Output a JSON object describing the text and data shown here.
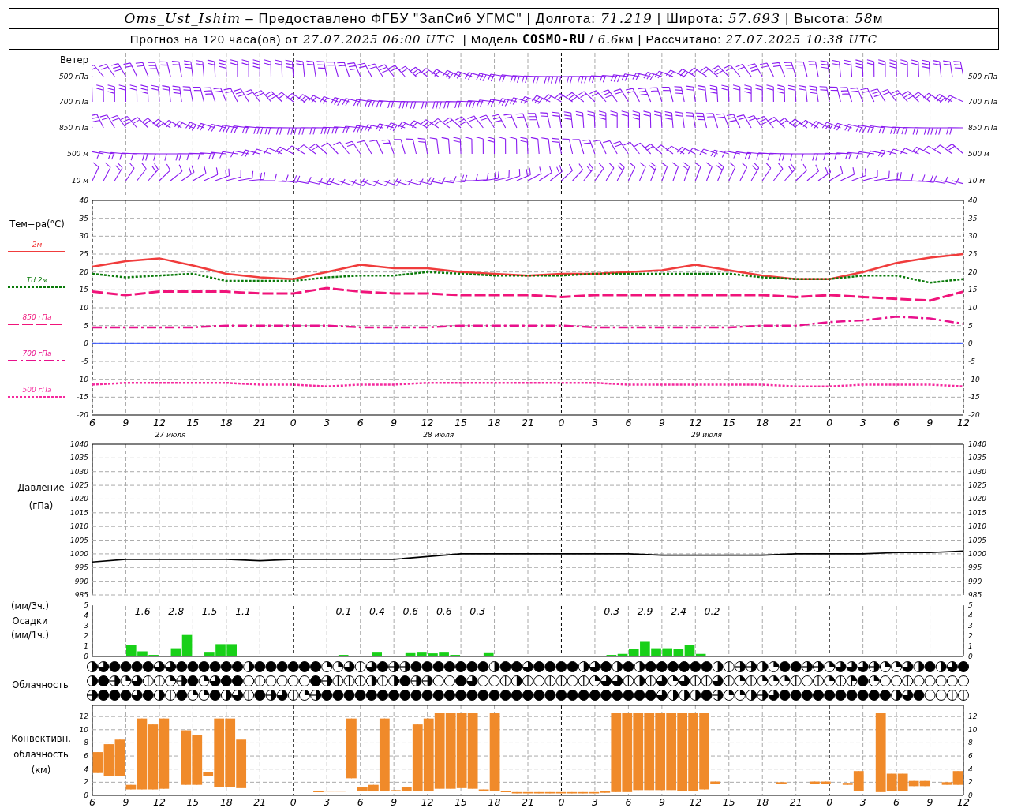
{
  "header": {
    "lines": [
      [
        {
          "text": "Oms_Ust_Ishim",
          "kind": "italic"
        },
        {
          "text": " – Предоставлено ФГБУ \"ЗапСиб УГМС\" | Долгота: ",
          "kind": "plain"
        },
        {
          "text": "71.219",
          "kind": "italic"
        },
        {
          "text": " | Широта: ",
          "kind": "plain"
        },
        {
          "text": "57.693",
          "kind": "italic"
        },
        {
          "text": " | Высота: ",
          "kind": "plain"
        },
        {
          "text": "58",
          "kind": "italic"
        },
        {
          "text": "м",
          "kind": "plain"
        }
      ],
      [
        {
          "text": "Прогноз на 120 часа(ов) от ",
          "kind": "plain"
        },
        {
          "text": "27.07.2025 06:00 UTC",
          "kind": "italic"
        },
        {
          "text": "  | Модель ",
          "kind": "plain"
        },
        {
          "text": "COSMO-RU",
          "kind": "bold"
        },
        {
          "text": " / ",
          "kind": "plain"
        },
        {
          "text": "6.6",
          "kind": "italic"
        },
        {
          "text": "км | Рассчитано: ",
          "kind": "plain"
        },
        {
          "text": "27.07.2025 10:38 UTC",
          "kind": "italic"
        }
      ]
    ]
  },
  "wind": {
    "title": "Ветер",
    "levels_left": [
      "500 гПа",
      "700 гПа",
      "850 гПа",
      "500 м",
      "10  м"
    ],
    "levels_right": [
      "500 гПа",
      "700 гПа",
      "850 гПа",
      "500 м",
      "10  м"
    ]
  },
  "temperature": {
    "chart_data": {
      "type": "line",
      "ylabel": "Тем−ра(°С)",
      "grid": true,
      "x": [
        "6",
        "9",
        "12",
        "15",
        "18",
        "21",
        "0",
        "3",
        "6",
        "9",
        "12",
        "15",
        "18",
        "21",
        "0",
        "3",
        "6",
        "9",
        "12",
        "15",
        "18",
        "21",
        "0",
        "3",
        "6",
        "9",
        "12"
      ],
      "ylim": [
        -20,
        40
      ],
      "yticks": [
        40,
        35,
        30,
        25,
        20,
        15,
        10,
        5,
        0,
        -5,
        -10,
        -15,
        -20
      ],
      "ref_lines": [
        {
          "axis": "y",
          "value": 0,
          "color": "#3050ff"
        }
      ],
      "series": [
        {
          "name": "2м",
          "color": "#f03c3c",
          "line_style": "solid",
          "values": [
            21.5,
            23,
            23.8,
            21.8,
            19.5,
            18.5,
            18,
            20,
            22,
            21,
            21,
            20,
            19.5,
            19,
            19.5,
            19.5,
            20,
            20.5,
            22,
            20.5,
            19,
            18,
            18,
            20,
            22.5,
            24,
            25
          ]
        },
        {
          "name": "Td  2м",
          "color": "#0a7a0a",
          "line_style": "dotted",
          "values": [
            19.5,
            18.5,
            19,
            19.5,
            17.5,
            17.5,
            17.5,
            18.5,
            19,
            19,
            20,
            19.5,
            19,
            19,
            19,
            19.5,
            19.5,
            19.5,
            19.5,
            19.5,
            18.5,
            18,
            18,
            19,
            19,
            17,
            18
          ]
        },
        {
          "name": "850 гПа",
          "color": "#f0147a",
          "line_style": "dashed",
          "values": [
            14.5,
            13.5,
            14.5,
            14.5,
            14.5,
            14,
            14,
            15.5,
            14.5,
            14,
            14,
            13.5,
            13.5,
            13.5,
            13,
            13.5,
            13.5,
            13.5,
            13.5,
            13.5,
            13.5,
            13,
            13.5,
            13,
            12.5,
            12,
            14.5
          ]
        },
        {
          "name": "700 гПа",
          "color": "#e8108c",
          "line_style": "dashdot",
          "values": [
            4.5,
            4.5,
            4.5,
            4.5,
            5,
            5,
            5,
            5,
            4.5,
            4.5,
            4.5,
            5,
            5,
            5,
            5,
            4.5,
            4.5,
            4.5,
            4.5,
            4.5,
            5,
            5,
            6,
            6.5,
            7.5,
            7,
            5.5
          ]
        },
        {
          "name": "500 гПа",
          "color": "#f52a9e",
          "line_style": "dotted",
          "values": [
            -11.5,
            -11,
            -11,
            -11,
            -11,
            -11.5,
            -11.5,
            -12,
            -11.5,
            -11.5,
            -11,
            -11,
            -11,
            -11,
            -11,
            -11,
            -11.5,
            -11.5,
            -11.5,
            -11.5,
            -11.5,
            -12,
            -12,
            -11.5,
            -11.5,
            -11.5,
            -12
          ]
        }
      ]
    },
    "right_ticks": [
      "40",
      "35",
      "30",
      "25",
      "20",
      "15",
      "10",
      "5",
      "0",
      "-5",
      "-10",
      "-15",
      "-20"
    ],
    "dates": [
      "27 июля",
      "28 июля",
      "29 июля"
    ]
  },
  "pressure": {
    "label": "Давление",
    "unit": "(гПа)",
    "chart_data": {
      "type": "line",
      "grid": true,
      "ylim": [
        985,
        1040
      ],
      "yticks": [
        1040,
        1035,
        1030,
        1025,
        1020,
        1015,
        1010,
        1005,
        1000,
        995,
        990,
        985
      ],
      "series": [
        {
          "color": "#000000",
          "values": [
            997,
            998,
            998,
            998,
            998,
            997.5,
            998,
            998,
            998,
            998,
            999,
            1000,
            1000,
            1000,
            1000,
            1000,
            1000,
            999.5,
            999.5,
            999.5,
            999.5,
            1000,
            1000,
            1000,
            1000.5,
            1000.5,
            1001
          ]
        }
      ]
    },
    "right_ticks": [
      "1040",
      "1035",
      "1030",
      "1025",
      "1020",
      "1015",
      "1010",
      "1005",
      "1000",
      "995",
      "990",
      "985"
    ]
  },
  "precipitation": {
    "unit_3h": "(мм/3ч.)",
    "label": "Осадки",
    "unit_1h": "(мм/1ч.)",
    "chart_data": {
      "type": "bar",
      "ylim": [
        0,
        5
      ],
      "yticks": [
        5,
        4,
        3,
        2,
        1,
        0
      ],
      "series": [
        {
          "color": "#18d018",
          "values": [
            0,
            0,
            0,
            1.1,
            0.5,
            0.15,
            0,
            0.8,
            2.1,
            0,
            0.45,
            1.2,
            1.2,
            0,
            0,
            0,
            0,
            0,
            0,
            0,
            0,
            0,
            0.15,
            0,
            0,
            0.45,
            0,
            0,
            0.4,
            0.45,
            0.3,
            0.45,
            0.15,
            0,
            0,
            0.4,
            0,
            0,
            0,
            0,
            0,
            0,
            0,
            0,
            0,
            0,
            0.15,
            0.25,
            0.75,
            1.5,
            0.8,
            0.8,
            0.7,
            1.1,
            0.25,
            0,
            0,
            0,
            0,
            0,
            0,
            0,
            0,
            0,
            0,
            0,
            0,
            0,
            0,
            0,
            0,
            0,
            0,
            0,
            0,
            0,
            0,
            0
          ]
        }
      ],
      "annotations": [
        "1.6",
        "2.8",
        "1.5",
        "1.1",
        "0.1",
        "0.4",
        "0.6",
        "0.6",
        "0.3",
        "0.3",
        "2.9",
        "2.4",
        "0.2"
      ]
    },
    "right_ticks": [
      "5",
      "4",
      "3",
      "2",
      "1",
      "0"
    ]
  },
  "cloudiness": {
    "label": "Облачность",
    "rows": [
      {
        "cells": [
          {
            "kind": "half"
          },
          {
            "kind": "mostly"
          },
          {
            "kind": "overcast"
          },
          {
            "kind": "overcast"
          },
          {
            "kind": "overcast"
          },
          {
            "kind": "overcast"
          },
          {
            "kind": "mostly"
          },
          {
            "kind": "mostly"
          },
          {
            "kind": "overcast"
          },
          {
            "kind": "overcast"
          },
          {
            "kind": "overcast"
          },
          {
            "kind": "overcast"
          },
          {
            "kind": "overcast"
          },
          {
            "kind": "overcast"
          },
          {
            "kind": "half"
          },
          {
            "kind": "overcast"
          },
          {
            "kind": "overcast"
          },
          {
            "kind": "overcast"
          },
          {
            "kind": "overcast"
          },
          {
            "kind": "overcast"
          },
          {
            "kind": "overcast"
          },
          {
            "kind": "quarter"
          },
          {
            "kind": "quarter"
          },
          {
            "kind": "mostly"
          },
          {
            "kind": "few"
          },
          {
            "kind": "mostly"
          },
          {
            "kind": "overcast"
          },
          {
            "kind": "broken"
          },
          {
            "kind": "broken"
          },
          {
            "kind": "overcast"
          },
          {
            "kind": "overcast"
          },
          {
            "kind": "overcast"
          },
          {
            "kind": "overcast"
          },
          {
            "kind": "overcast"
          },
          {
            "kind": "overcast"
          },
          {
            "kind": "overcast"
          },
          {
            "kind": "half"
          },
          {
            "kind": "overcast"
          },
          {
            "kind": "overcast"
          },
          {
            "kind": "mostly"
          },
          {
            "kind": "overcast"
          },
          {
            "kind": "overcast"
          },
          {
            "kind": "overcast"
          },
          {
            "kind": "overcast"
          },
          {
            "kind": "half"
          },
          {
            "kind": "mostly"
          },
          {
            "kind": "overcast"
          },
          {
            "kind": "half"
          },
          {
            "kind": "overcast"
          },
          {
            "kind": "half"
          },
          {
            "kind": "overcast"
          },
          {
            "kind": "overcast"
          },
          {
            "kind": "overcast"
          },
          {
            "kind": "overcast"
          },
          {
            "kind": "overcast"
          },
          {
            "kind": "overcast"
          },
          {
            "kind": "half"
          },
          {
            "kind": "few"
          },
          {
            "kind": "broken"
          },
          {
            "kind": "broken"
          },
          {
            "kind": "half"
          },
          {
            "kind": "quarter"
          },
          {
            "kind": "overcast"
          },
          {
            "kind": "overcast"
          },
          {
            "kind": "broken"
          },
          {
            "kind": "broken"
          },
          {
            "kind": "quarter"
          },
          {
            "kind": "mostly"
          },
          {
            "kind": "mostly"
          },
          {
            "kind": "mostly"
          },
          {
            "kind": "broken"
          },
          {
            "kind": "quarter"
          },
          {
            "kind": "quarter"
          },
          {
            "kind": "mostly"
          },
          {
            "kind": "half"
          },
          {
            "kind": "overcast"
          },
          {
            "kind": "half"
          },
          {
            "kind": "mostly"
          },
          {
            "kind": "overcast"
          }
        ]
      },
      {
        "cells": [
          {
            "kind": "half"
          },
          {
            "kind": "overcast"
          },
          {
            "kind": "broken"
          },
          {
            "kind": "quarter"
          },
          {
            "kind": "mostly"
          },
          {
            "kind": "few"
          },
          {
            "kind": "few"
          },
          {
            "kind": "quarter"
          },
          {
            "kind": "broken"
          },
          {
            "kind": "overcast"
          },
          {
            "kind": "quarter"
          },
          {
            "kind": "mostly"
          },
          {
            "kind": "overcast"
          },
          {
            "kind": "overcast"
          },
          {
            "kind": "clear"
          },
          {
            "kind": "few"
          },
          {
            "kind": "clear"
          },
          {
            "kind": "clear"
          },
          {
            "kind": "clear"
          },
          {
            "kind": "clear"
          },
          {
            "kind": "overcast"
          },
          {
            "kind": "broken"
          },
          {
            "kind": "few"
          },
          {
            "kind": "few"
          },
          {
            "kind": "few"
          },
          {
            "kind": "half"
          },
          {
            "kind": "few"
          },
          {
            "kind": "half"
          },
          {
            "kind": "overcast"
          },
          {
            "kind": "broken"
          },
          {
            "kind": "broken"
          },
          {
            "kind": "clear"
          },
          {
            "kind": "clear"
          },
          {
            "kind": "overcast"
          },
          {
            "kind": "mostly"
          },
          {
            "kind": "clear"
          },
          {
            "kind": "clear"
          },
          {
            "kind": "few"
          },
          {
            "kind": "half"
          },
          {
            "kind": "few"
          },
          {
            "kind": "clear"
          },
          {
            "kind": "few"
          },
          {
            "kind": "few"
          },
          {
            "kind": "clear"
          },
          {
            "kind": "few"
          },
          {
            "kind": "quarter"
          },
          {
            "kind": "mostly"
          },
          {
            "kind": "mostly"
          },
          {
            "kind": "few"
          },
          {
            "kind": "half"
          },
          {
            "kind": "few"
          },
          {
            "kind": "mostly"
          },
          {
            "kind": "quarter"
          },
          {
            "kind": "mostly"
          },
          {
            "kind": "few"
          },
          {
            "kind": "few"
          },
          {
            "kind": "mostly"
          },
          {
            "kind": "few"
          },
          {
            "kind": "quarter"
          },
          {
            "kind": "few"
          },
          {
            "kind": "quarter"
          },
          {
            "kind": "quarter"
          },
          {
            "kind": "quarter"
          },
          {
            "kind": "few"
          },
          {
            "kind": "clear"
          },
          {
            "kind": "few"
          },
          {
            "kind": "quarter"
          },
          {
            "kind": "few"
          },
          {
            "kind": "scattered"
          },
          {
            "kind": "overcast"
          },
          {
            "kind": "quarter"
          },
          {
            "kind": "clear"
          },
          {
            "kind": "clear"
          },
          {
            "kind": "few"
          },
          {
            "kind": "clear"
          },
          {
            "kind": "clear"
          },
          {
            "kind": "clear"
          },
          {
            "kind": "clear"
          },
          {
            "kind": "clear"
          }
        ]
      },
      {
        "cells": [
          {
            "kind": "broken"
          },
          {
            "kind": "overcast"
          },
          {
            "kind": "overcast"
          },
          {
            "kind": "overcast"
          },
          {
            "kind": "mostly"
          },
          {
            "kind": "overcast"
          },
          {
            "kind": "half"
          },
          {
            "kind": "few"
          },
          {
            "kind": "overcast"
          },
          {
            "kind": "quarter"
          },
          {
            "kind": "quarter"
          },
          {
            "kind": "overcast"
          },
          {
            "kind": "half"
          },
          {
            "kind": "mostly"
          },
          {
            "kind": "few"
          },
          {
            "kind": "overcast"
          },
          {
            "kind": "broken"
          },
          {
            "kind": "mostly"
          },
          {
            "kind": "few"
          },
          {
            "kind": "quarter"
          },
          {
            "kind": "broken"
          },
          {
            "kind": "overcast"
          },
          {
            "kind": "overcast"
          },
          {
            "kind": "overcast"
          },
          {
            "kind": "overcast"
          },
          {
            "kind": "overcast"
          },
          {
            "kind": "overcast"
          },
          {
            "kind": "overcast"
          },
          {
            "kind": "overcast"
          },
          {
            "kind": "overcast"
          },
          {
            "kind": "overcast"
          },
          {
            "kind": "overcast"
          },
          {
            "kind": "overcast"
          },
          {
            "kind": "overcast"
          },
          {
            "kind": "overcast"
          },
          {
            "kind": "overcast"
          },
          {
            "kind": "overcast"
          },
          {
            "kind": "overcast"
          },
          {
            "kind": "overcast"
          },
          {
            "kind": "overcast"
          },
          {
            "kind": "overcast"
          },
          {
            "kind": "overcast"
          },
          {
            "kind": "overcast"
          },
          {
            "kind": "overcast"
          },
          {
            "kind": "overcast"
          },
          {
            "kind": "overcast"
          },
          {
            "kind": "overcast"
          },
          {
            "kind": "overcast"
          },
          {
            "kind": "overcast"
          },
          {
            "kind": "overcast"
          },
          {
            "kind": "overcast"
          },
          {
            "kind": "mostly"
          },
          {
            "kind": "half"
          },
          {
            "kind": "half"
          },
          {
            "kind": "half"
          },
          {
            "kind": "overcast"
          },
          {
            "kind": "broken"
          },
          {
            "kind": "quarter"
          },
          {
            "kind": "quarter"
          },
          {
            "kind": "half"
          },
          {
            "kind": "broken"
          },
          {
            "kind": "mostly"
          },
          {
            "kind": "overcast"
          },
          {
            "kind": "overcast"
          },
          {
            "kind": "overcast"
          },
          {
            "kind": "overcast"
          },
          {
            "kind": "overcast"
          },
          {
            "kind": "overcast"
          },
          {
            "kind": "overcast"
          },
          {
            "kind": "overcast"
          },
          {
            "kind": "overcast"
          },
          {
            "kind": "overcast"
          },
          {
            "kind": "half"
          },
          {
            "kind": "mostly"
          },
          {
            "kind": "overcast"
          },
          {
            "kind": "clear"
          },
          {
            "kind": "clear"
          },
          {
            "kind": "few"
          },
          {
            "kind": "few"
          }
        ]
      }
    ]
  },
  "convective_cloud": {
    "label_lines": [
      "Конвективн.",
      "облачность",
      "(км)"
    ],
    "chart_data": {
      "type": "candlestick",
      "grid": true,
      "ylim": [
        0,
        13.7
      ],
      "yticks": [
        12,
        10,
        8,
        6,
        4,
        2,
        0
      ],
      "ohlc": [
        [
          3.4,
          6.6,
          3.4,
          6.6
        ],
        [
          3,
          7.8,
          3,
          7.8
        ],
        [
          3,
          8.5,
          3,
          8.5
        ],
        [
          0.9,
          1.6,
          0.9,
          1.6
        ],
        [
          0.9,
          11.7,
          0.9,
          11.7
        ],
        [
          0.9,
          10.8,
          0.9,
          10.8
        ],
        [
          1,
          11.7,
          1,
          11.7
        ],
        null,
        [
          1.6,
          9.9,
          1.6,
          9.9
        ],
        [
          1.6,
          9.2,
          1.6,
          9.2
        ],
        [
          3,
          3.6,
          3,
          3.6
        ],
        [
          1.3,
          11.7,
          1.3,
          11.7
        ],
        [
          1.3,
          11.7,
          1.3,
          11.7
        ],
        [
          1.1,
          8.5,
          1.1,
          8.5
        ],
        null,
        null,
        null,
        null,
        null,
        null,
        [
          0.5,
          0.6,
          0.5,
          0.6
        ],
        [
          0.6,
          0.7,
          0.6,
          0.7
        ],
        [
          0.6,
          0.7,
          0.6,
          0.7
        ],
        [
          2.6,
          11.7,
          2.6,
          11.7
        ],
        [
          0.6,
          1.2,
          0.6,
          1.2
        ],
        [
          0.6,
          1.6,
          0.6,
          1.6
        ],
        [
          0.6,
          11.7,
          0.6,
          11.7
        ],
        [
          0.6,
          0.8,
          0.6,
          0.8
        ],
        [
          0.6,
          1.2,
          0.6,
          1.2
        ],
        [
          0.6,
          10.8,
          0.6,
          10.8
        ],
        [
          0.6,
          11.7,
          0.6,
          11.7
        ],
        [
          1,
          12.5,
          1,
          12.5
        ],
        [
          1,
          12.5,
          1,
          12.5
        ],
        [
          1.1,
          12.5,
          1.1,
          12.5
        ],
        [
          1,
          12.5,
          1,
          12.5
        ],
        [
          0.6,
          0.9,
          0.6,
          0.9
        ],
        [
          0.6,
          12.5,
          0.6,
          12.5
        ],
        [
          0.5,
          0.6,
          0.5,
          0.6
        ],
        [
          0.3,
          0.5,
          0.3,
          0.5
        ],
        [
          0.3,
          0.5,
          0.3,
          0.5
        ],
        [
          0.3,
          0.5,
          0.3,
          0.5
        ],
        [
          0.3,
          0.5,
          0.3,
          0.5
        ],
        [
          0.3,
          0.5,
          0.3,
          0.5
        ],
        [
          0.3,
          0.5,
          0.3,
          0.5
        ],
        [
          0.3,
          0.5,
          0.3,
          0.5
        ],
        [
          0.3,
          0.5,
          0.3,
          0.5
        ],
        [
          0.4,
          0.6,
          0.4,
          0.6
        ],
        [
          0.5,
          12.5,
          0.5,
          12.5
        ],
        [
          0.5,
          12.5,
          0.5,
          12.5
        ],
        [
          0.8,
          12.5,
          0.8,
          12.5
        ],
        [
          0.8,
          12.5,
          0.8,
          12.5
        ],
        [
          0.8,
          12.5,
          0.8,
          12.5
        ],
        [
          0.8,
          12.5,
          0.8,
          12.5
        ],
        [
          0.6,
          12.5,
          0.6,
          12.5
        ],
        [
          0.6,
          12.5,
          0.6,
          12.5
        ],
        [
          0.9,
          12.5,
          0.9,
          12.5
        ],
        [
          1.8,
          2.1,
          1.8,
          2.1
        ],
        null,
        null,
        null,
        null,
        null,
        [
          1.7,
          2,
          1.7,
          2
        ],
        null,
        null,
        [
          1.8,
          2.1,
          1.8,
          2.1
        ],
        [
          1.8,
          2.1,
          1.8,
          2.1
        ],
        null,
        [
          1.6,
          1.9,
          1.6,
          1.9
        ],
        [
          0.6,
          3.7,
          0.6,
          3.7
        ],
        null,
        [
          0.5,
          12.5,
          0.5,
          12.5
        ],
        [
          0.6,
          3.3,
          0.6,
          3.3
        ],
        [
          0.6,
          3.3,
          0.6,
          3.3
        ],
        [
          1.4,
          2.2,
          1.4,
          2.2
        ],
        [
          1.4,
          2.2,
          1.4,
          2.2
        ],
        null,
        [
          1.6,
          2,
          1.6,
          2
        ],
        [
          1.6,
          3.7,
          1.6,
          3.7
        ]
      ]
    },
    "right_ticks": [
      "12",
      "10",
      "8",
      "6",
      "4",
      "2",
      "0"
    ]
  },
  "bottom_axis": {
    "labels": [
      "6",
      "9",
      "12",
      "15",
      "18",
      "21",
      "0",
      "3",
      "6",
      "9",
      "12",
      "15",
      "18",
      "21",
      "0",
      "3",
      "6",
      "9",
      "12",
      "15",
      "18",
      "21",
      "0",
      "3",
      "6",
      "9",
      "12"
    ]
  }
}
